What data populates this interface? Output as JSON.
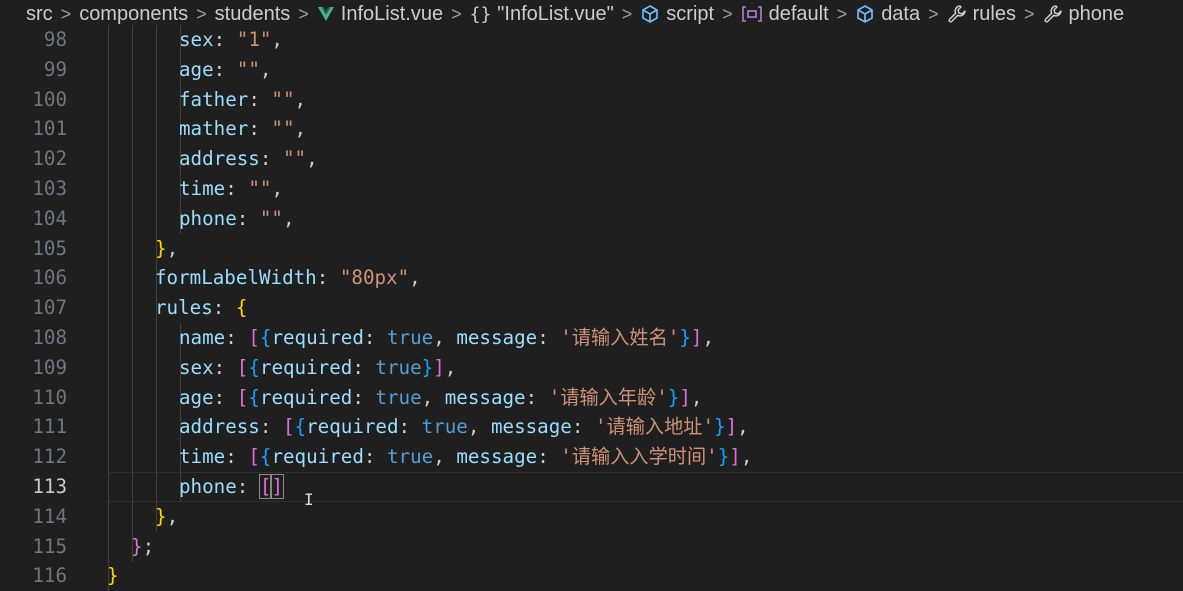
{
  "breadcrumb": {
    "items": [
      {
        "label": "src",
        "icon": "none"
      },
      {
        "label": "components",
        "icon": "none"
      },
      {
        "label": "students",
        "icon": "none"
      },
      {
        "label": "InfoList.vue",
        "icon": "vue-icon"
      },
      {
        "label": "\"InfoList.vue\"",
        "icon": "braces-icon"
      },
      {
        "label": "script",
        "icon": "cube-icon"
      },
      {
        "label": "default",
        "icon": "module-icon"
      },
      {
        "label": "data",
        "icon": "cube-icon"
      },
      {
        "label": "rules",
        "icon": "wrench-icon"
      },
      {
        "label": "phone",
        "icon": "wrench-icon"
      }
    ],
    "separator": ">"
  },
  "colors": {
    "background": "#1f1f1f",
    "key": "#9cdcfe",
    "string": "#ce9178",
    "boolean": "#569cd6",
    "bracket1": "#ffd700",
    "bracket2": "#da70d6",
    "bracket3": "#179fff"
  },
  "editor": {
    "current_line": 113,
    "lines": [
      {
        "n": "98",
        "indent": 4,
        "tokens": [
          [
            "k",
            "sex"
          ],
          [
            "p",
            ": "
          ],
          [
            "s",
            "\"1\""
          ],
          [
            "p",
            ","
          ]
        ]
      },
      {
        "n": "99",
        "indent": 4,
        "tokens": [
          [
            "k",
            "age"
          ],
          [
            "p",
            ": "
          ],
          [
            "s",
            "\"\""
          ],
          [
            "p",
            ","
          ]
        ]
      },
      {
        "n": "100",
        "indent": 4,
        "tokens": [
          [
            "k",
            "father"
          ],
          [
            "p",
            ": "
          ],
          [
            "s",
            "\"\""
          ],
          [
            "p",
            ","
          ]
        ]
      },
      {
        "n": "101",
        "indent": 4,
        "tokens": [
          [
            "k",
            "mather"
          ],
          [
            "p",
            ": "
          ],
          [
            "s",
            "\"\""
          ],
          [
            "p",
            ","
          ]
        ]
      },
      {
        "n": "102",
        "indent": 4,
        "tokens": [
          [
            "k",
            "address"
          ],
          [
            "p",
            ": "
          ],
          [
            "s",
            "\"\""
          ],
          [
            "p",
            ","
          ]
        ]
      },
      {
        "n": "103",
        "indent": 4,
        "tokens": [
          [
            "k",
            "time"
          ],
          [
            "p",
            ": "
          ],
          [
            "s",
            "\"\""
          ],
          [
            "p",
            ","
          ]
        ]
      },
      {
        "n": "104",
        "indent": 4,
        "tokens": [
          [
            "k",
            "phone"
          ],
          [
            "p",
            ": "
          ],
          [
            "s",
            "\"\""
          ],
          [
            "p",
            ","
          ]
        ]
      },
      {
        "n": "105",
        "indent": 3,
        "tokens": [
          [
            "y",
            "}"
          ],
          [
            "p",
            ","
          ]
        ]
      },
      {
        "n": "106",
        "indent": 3,
        "tokens": [
          [
            "k",
            "formLabelWidth"
          ],
          [
            "p",
            ": "
          ],
          [
            "s",
            "\"80px\""
          ],
          [
            "p",
            ","
          ]
        ]
      },
      {
        "n": "107",
        "indent": 3,
        "tokens": [
          [
            "k",
            "rules"
          ],
          [
            "p",
            ": "
          ],
          [
            "y",
            "{"
          ]
        ]
      },
      {
        "n": "108",
        "indent": 4,
        "tokens": [
          [
            "k",
            "name"
          ],
          [
            "p",
            ": "
          ],
          [
            "m",
            "["
          ],
          [
            "c",
            "{"
          ],
          [
            "k",
            "required"
          ],
          [
            "p",
            ": "
          ],
          [
            "b",
            "true"
          ],
          [
            "p",
            ", "
          ],
          [
            "k",
            "message"
          ],
          [
            "p",
            ": "
          ],
          [
            "s",
            "'请输入姓名'"
          ],
          [
            "c",
            "}"
          ],
          [
            "m",
            "]"
          ],
          [
            "p",
            ","
          ]
        ]
      },
      {
        "n": "109",
        "indent": 4,
        "tokens": [
          [
            "k",
            "sex"
          ],
          [
            "p",
            ": "
          ],
          [
            "m",
            "["
          ],
          [
            "c",
            "{"
          ],
          [
            "k",
            "required"
          ],
          [
            "p",
            ": "
          ],
          [
            "b",
            "true"
          ],
          [
            "c",
            "}"
          ],
          [
            "m",
            "]"
          ],
          [
            "p",
            ","
          ]
        ]
      },
      {
        "n": "110",
        "indent": 4,
        "tokens": [
          [
            "k",
            "age"
          ],
          [
            "p",
            ": "
          ],
          [
            "m",
            "["
          ],
          [
            "c",
            "{"
          ],
          [
            "k",
            "required"
          ],
          [
            "p",
            ": "
          ],
          [
            "b",
            "true"
          ],
          [
            "p",
            ", "
          ],
          [
            "k",
            "message"
          ],
          [
            "p",
            ": "
          ],
          [
            "s",
            "'请输入年龄'"
          ],
          [
            "c",
            "}"
          ],
          [
            "m",
            "]"
          ],
          [
            "p",
            ","
          ]
        ]
      },
      {
        "n": "111",
        "indent": 4,
        "tokens": [
          [
            "k",
            "address"
          ],
          [
            "p",
            ": "
          ],
          [
            "m",
            "["
          ],
          [
            "c",
            "{"
          ],
          [
            "k",
            "required"
          ],
          [
            "p",
            ": "
          ],
          [
            "b",
            "true"
          ],
          [
            "p",
            ", "
          ],
          [
            "k",
            "message"
          ],
          [
            "p",
            ": "
          ],
          [
            "s",
            "'请输入地址'"
          ],
          [
            "c",
            "}"
          ],
          [
            "m",
            "]"
          ],
          [
            "p",
            ","
          ]
        ]
      },
      {
        "n": "112",
        "indent": 4,
        "tokens": [
          [
            "k",
            "time"
          ],
          [
            "p",
            ": "
          ],
          [
            "m",
            "["
          ],
          [
            "c",
            "{"
          ],
          [
            "k",
            "required"
          ],
          [
            "p",
            ": "
          ],
          [
            "b",
            "true"
          ],
          [
            "p",
            ", "
          ],
          [
            "k",
            "message"
          ],
          [
            "p",
            ": "
          ],
          [
            "s",
            "'请输入入学时间'"
          ],
          [
            "c",
            "}"
          ],
          [
            "m",
            "]"
          ],
          [
            "p",
            ","
          ]
        ]
      },
      {
        "n": "113",
        "indent": 4,
        "tokens": [
          [
            "k",
            "phone"
          ],
          [
            "p",
            ": "
          ],
          [
            "mbox",
            "["
          ],
          [
            "cursor",
            ""
          ],
          [
            "mbox",
            "]"
          ]
        ]
      },
      {
        "n": "114",
        "indent": 3,
        "tokens": [
          [
            "y",
            "}"
          ],
          [
            "p",
            ","
          ]
        ]
      },
      {
        "n": "115",
        "indent": 2,
        "tokens": [
          [
            "m",
            "}"
          ],
          [
            "p",
            ";"
          ]
        ]
      },
      {
        "n": "116",
        "indent": 1,
        "tokens": [
          [
            "y",
            "}"
          ]
        ]
      }
    ]
  }
}
